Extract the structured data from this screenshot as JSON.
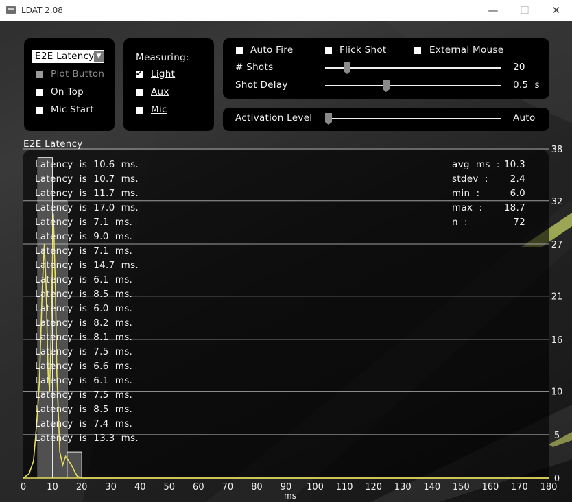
{
  "window": {
    "title": "LDAT 2.08",
    "minimize_glyph": "—",
    "maximize_glyph": "☐",
    "close_glyph": "✕"
  },
  "mode_panel": {
    "selected_mode": "E2E Latency",
    "options": [
      {
        "label": "Plot Button",
        "checked": false,
        "enabled": false
      },
      {
        "label": "On Top",
        "checked": false,
        "enabled": true
      },
      {
        "label": "Mic Start",
        "checked": false,
        "enabled": true
      }
    ]
  },
  "measuring_panel": {
    "title": "Measuring:",
    "options": [
      {
        "label": "Light",
        "checked": true
      },
      {
        "label": "Aux",
        "checked": false
      },
      {
        "label": "Mic",
        "checked": false
      }
    ]
  },
  "fire_panel": {
    "auto_fire": {
      "label": "Auto Fire",
      "checked": false
    },
    "flick_shot": {
      "label": "Flick Shot",
      "checked": false
    },
    "external_mouse": {
      "label": "External Mouse",
      "checked": false
    },
    "shots": {
      "label": "# Shots",
      "value": "20",
      "fraction": 0.11
    },
    "shot_delay": {
      "label": "Shot Delay",
      "value": "0.5  s",
      "fraction": 0.34
    }
  },
  "activation": {
    "label": "Activation Level",
    "value": "Auto",
    "fraction": 0.0
  },
  "readings": [
    "Latency  is  10.6  ms.",
    "Latency  is  10.7  ms.",
    "Latency  is  11.7  ms.",
    "Latency  is  17.0  ms.",
    "Latency  is  7.1  ms.",
    "Latency  is  9.0  ms.",
    "Latency  is  7.1  ms.",
    "Latency  is  14.7  ms.",
    "Latency  is  6.1  ms.",
    "Latency  is  8.5  ms.",
    "Latency  is  6.0  ms.",
    "Latency  is  8.2  ms.",
    "Latency  is  8.1  ms.",
    "Latency  is  7.5  ms.",
    "Latency  is  6.6  ms.",
    "Latency  is  6.1  ms.",
    "Latency  is  7.5  ms.",
    "Latency  is  8.5  ms.",
    "Latency  is  7.4  ms.",
    "Latency  is  13.3  ms."
  ],
  "stats": [
    {
      "label": "avg  ms  :",
      "value": "10.3"
    },
    {
      "label": "stdev  :",
      "value": "2.4"
    },
    {
      "label": "min  :",
      "value": "6.0"
    },
    {
      "label": "max  :",
      "value": "18.7"
    },
    {
      "label": "n  :",
      "value": "72"
    }
  ],
  "chart_data": {
    "type": "bar",
    "title": "E2E Latency",
    "xlabel": "ms",
    "ylabel": "",
    "xlim": [
      0,
      180
    ],
    "ylim": [
      0,
      38
    ],
    "xticks": [
      0,
      10,
      20,
      30,
      40,
      50,
      60,
      70,
      80,
      90,
      100,
      110,
      120,
      130,
      140,
      150,
      160,
      170,
      180
    ],
    "yticks": [
      0,
      5,
      10,
      16,
      21,
      27,
      32,
      38
    ],
    "grid": true,
    "bin_width": 5,
    "bins": [
      {
        "x0": 5,
        "x1": 10,
        "count": 37
      },
      {
        "x0": 10,
        "x1": 15,
        "count": 32
      },
      {
        "x0": 15,
        "x1": 20,
        "count": 3
      }
    ],
    "density_curve": {
      "color": "#e8e060",
      "points": [
        [
          0,
          0
        ],
        [
          2,
          0.5
        ],
        [
          3.5,
          2
        ],
        [
          4.5,
          6
        ],
        [
          5.5,
          11
        ],
        [
          6.5,
          22
        ],
        [
          7.2,
          27
        ],
        [
          7.8,
          22
        ],
        [
          8.5,
          12
        ],
        [
          9,
          10
        ],
        [
          9.5,
          16
        ],
        [
          10.3,
          30.5
        ],
        [
          11,
          22
        ],
        [
          11.5,
          12
        ],
        [
          12.5,
          3
        ],
        [
          13.5,
          1.5
        ],
        [
          14.5,
          2.5
        ],
        [
          15.5,
          2
        ],
        [
          16.5,
          1.5
        ],
        [
          17.5,
          0.8
        ],
        [
          18.5,
          0.2
        ],
        [
          20,
          0
        ],
        [
          180,
          0
        ]
      ]
    },
    "bar_color": "#a0a0a0"
  }
}
